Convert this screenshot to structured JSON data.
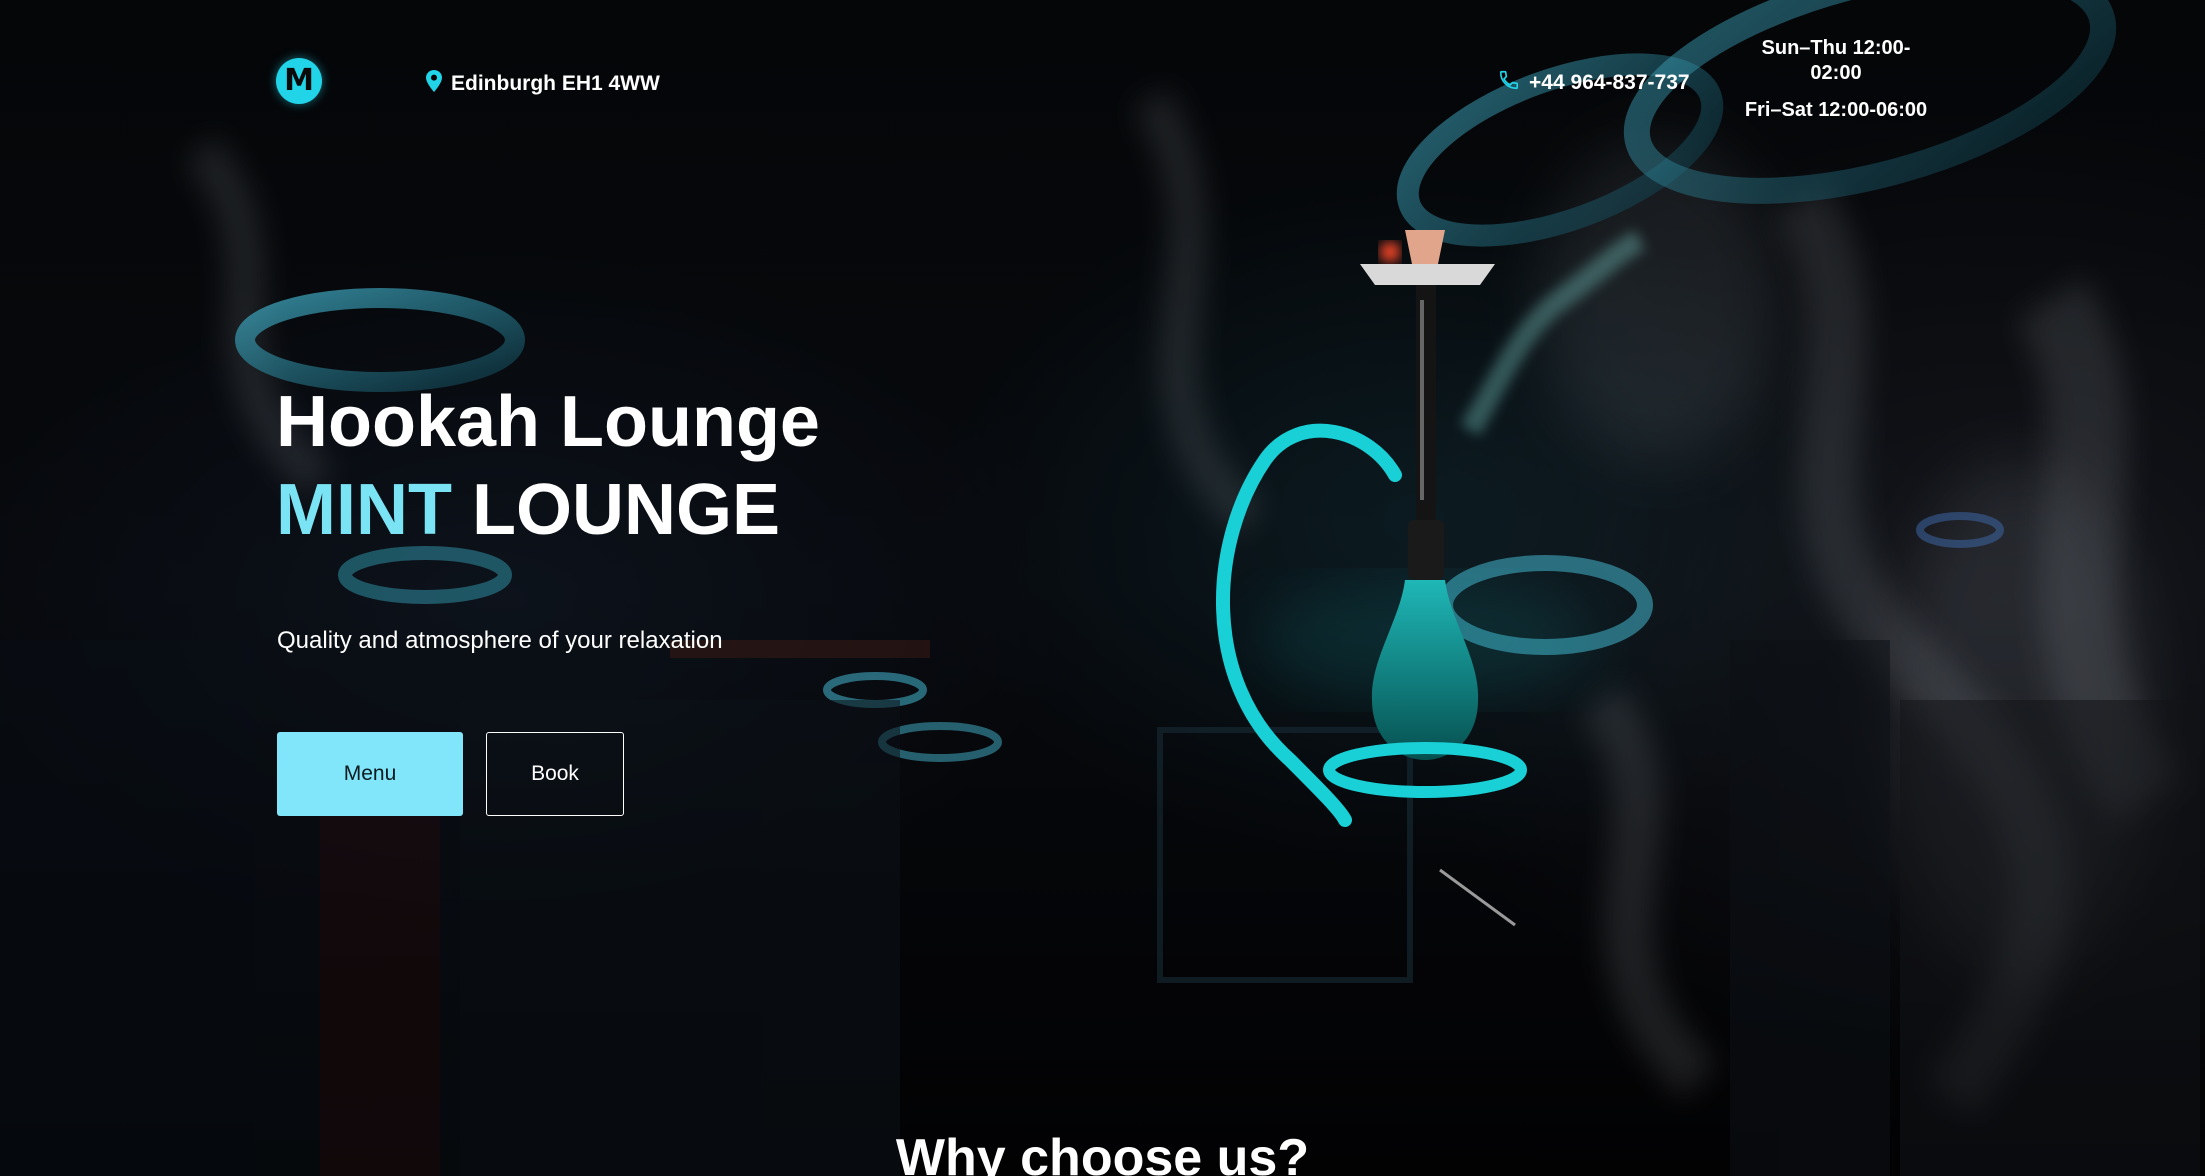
{
  "header": {
    "logo_letter": "M",
    "address": "Edinburgh EH1 4WW",
    "phone": "+44 964-837-737",
    "hours_weekday": "Sun–Thu 12:00-02:00",
    "hours_weekend": "Fri–Sat 12:00-06:00"
  },
  "hero": {
    "title_line1": "Hookah Lounge",
    "title_accent": "MINT",
    "title_rest": "LOUNGE",
    "tagline": "Quality and atmosphere of your relaxation",
    "menu_button": "Menu",
    "book_button": "Book"
  },
  "next_section": {
    "title": "Why choose us?"
  },
  "icons": {
    "location": "location-pin-icon",
    "phone": "phone-icon"
  },
  "colors": {
    "accent": "#7ae4f4",
    "button_fill": "#82e6fa",
    "logo": "#21d4e8",
    "background": "#000000"
  }
}
